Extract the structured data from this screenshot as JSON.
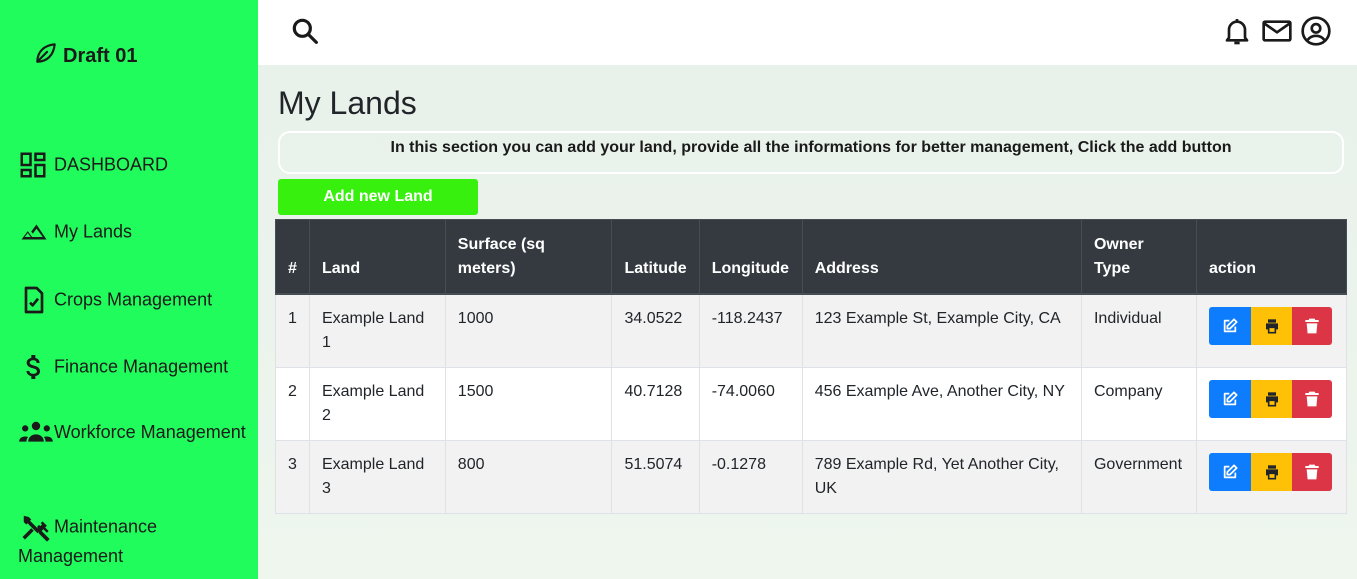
{
  "brand": {
    "name": "Draft 01",
    "icon": "leaf-icon"
  },
  "sidebar": {
    "items": [
      {
        "label": "DASHBOARD",
        "icon": "dashboard-icon"
      },
      {
        "label": "My Lands",
        "icon": "terrain-icon"
      },
      {
        "label": "Crops Management",
        "icon": "clipboard-check-icon"
      },
      {
        "label": "Finance Management",
        "icon": "dollar-icon"
      },
      {
        "label": "Workforce Management",
        "icon": "people-icon"
      },
      {
        "label": "Maintenance Management",
        "icon": "tools-icon"
      }
    ]
  },
  "topbar": {
    "icons": [
      "search-icon",
      "bell-icon",
      "mail-icon",
      "account-icon"
    ]
  },
  "page": {
    "title": "My Lands",
    "info": "In this section you can add your land, provide all the informations for better management, Click the add button",
    "add_button": "Add new Land"
  },
  "table": {
    "headers": [
      "#",
      "Land",
      "Surface (sq meters)",
      "Latitude",
      "Longitude",
      "Address",
      "Owner Type",
      "action"
    ],
    "rows": [
      {
        "num": "1",
        "land": "Example Land 1",
        "surface": "1000",
        "lat": "34.0522",
        "lng": "-118.2437",
        "address": "123 Example St, Example City, CA",
        "owner": "Individual"
      },
      {
        "num": "2",
        "land": "Example Land 2",
        "surface": "1500",
        "lat": "40.7128",
        "lng": "-74.0060",
        "address": "456 Example Ave, Another City, NY",
        "owner": "Company"
      },
      {
        "num": "3",
        "land": "Example Land 3",
        "surface": "800",
        "lat": "51.5074",
        "lng": "-0.1278",
        "address": "789 Example Rd, Yet Another City, UK",
        "owner": "Government"
      }
    ]
  },
  "colors": {
    "sidebar": "#20fc5c",
    "add_button": "#38f00e",
    "header": "#343a40",
    "edit": "#0d7cfd",
    "print": "#ffc107",
    "delete": "#dc3545"
  }
}
